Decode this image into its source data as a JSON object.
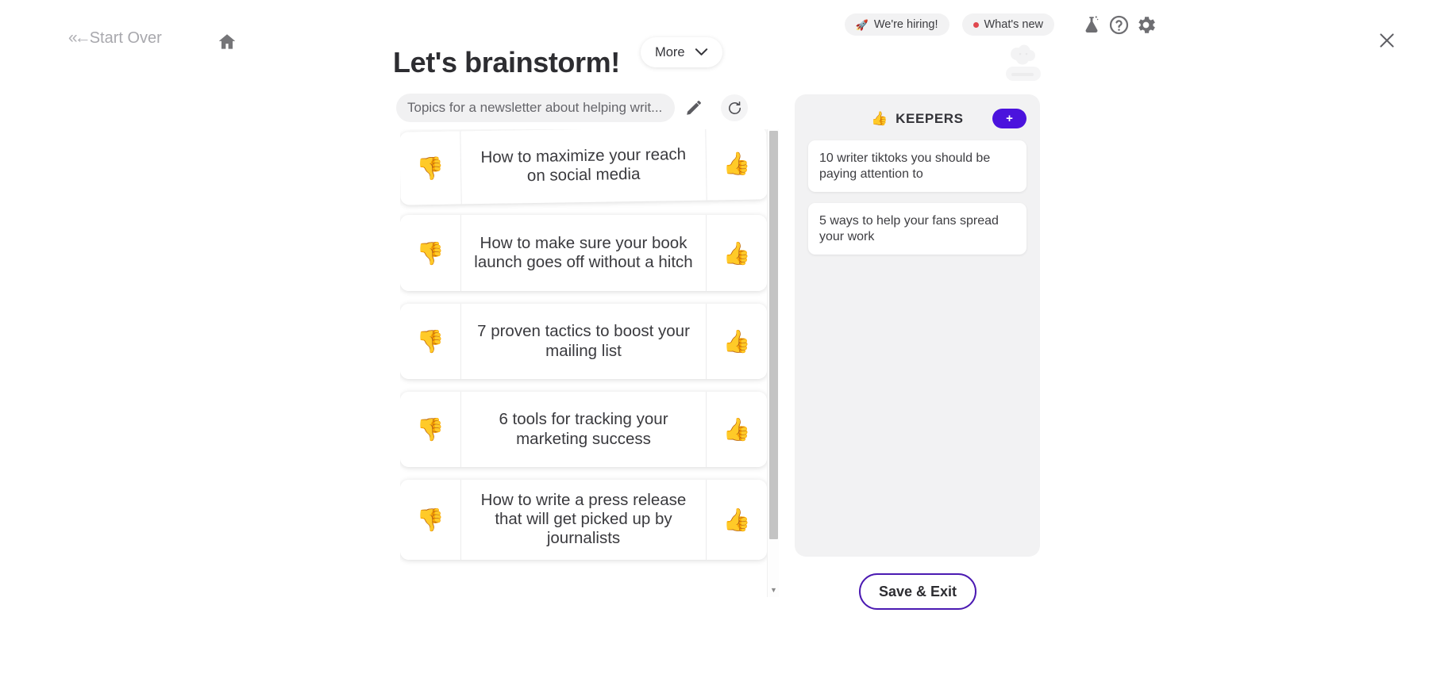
{
  "nav": {
    "start_over_label": "Start Over",
    "start_over_arrows": "«←",
    "home_icon": "home-icon"
  },
  "topbar": {
    "hiring_label": "We're hiring!",
    "hiring_icon": "rocket-icon",
    "whats_new_label": "What's new",
    "whats_new_dot_color": "#e0484f",
    "labs_icon": "flask-icon",
    "help_icon": "help-circle-icon",
    "settings_icon": "gear-icon",
    "close_icon": "close-icon"
  },
  "header": {
    "title": "Let's brainstorm!",
    "more_label": "More",
    "more_icon": "chevron-down-icon"
  },
  "prompt": {
    "value": "Topics for a newsletter about helping writ...",
    "edit_icon": "pencil-icon",
    "refresh_icon": "refresh-icon"
  },
  "ideas": {
    "vote_down_icon": "thumbs-down-icon",
    "vote_up_icon": "thumbs-up-icon",
    "items": [
      {
        "text": "How to maximize your reach on social media"
      },
      {
        "text": "How to make sure your book launch goes off without a hitch"
      },
      {
        "text": "7 proven tactics to boost your mailing list"
      },
      {
        "text": "6 tools for tracking your marketing success"
      },
      {
        "text": "How to write a press release that will get picked up by journalists"
      }
    ]
  },
  "keepers": {
    "title": "KEEPERS",
    "title_icon": "thumbs-up-icon",
    "add_label": "+",
    "accent_color": "#4b13dd",
    "items": [
      {
        "text": "10 writer tiktoks you should be paying attention to"
      },
      {
        "text": "5 ways to help your fans spread your work"
      }
    ]
  },
  "footer": {
    "save_exit_label": "Save & Exit",
    "save_exit_border_color": "#4b1ab2"
  }
}
